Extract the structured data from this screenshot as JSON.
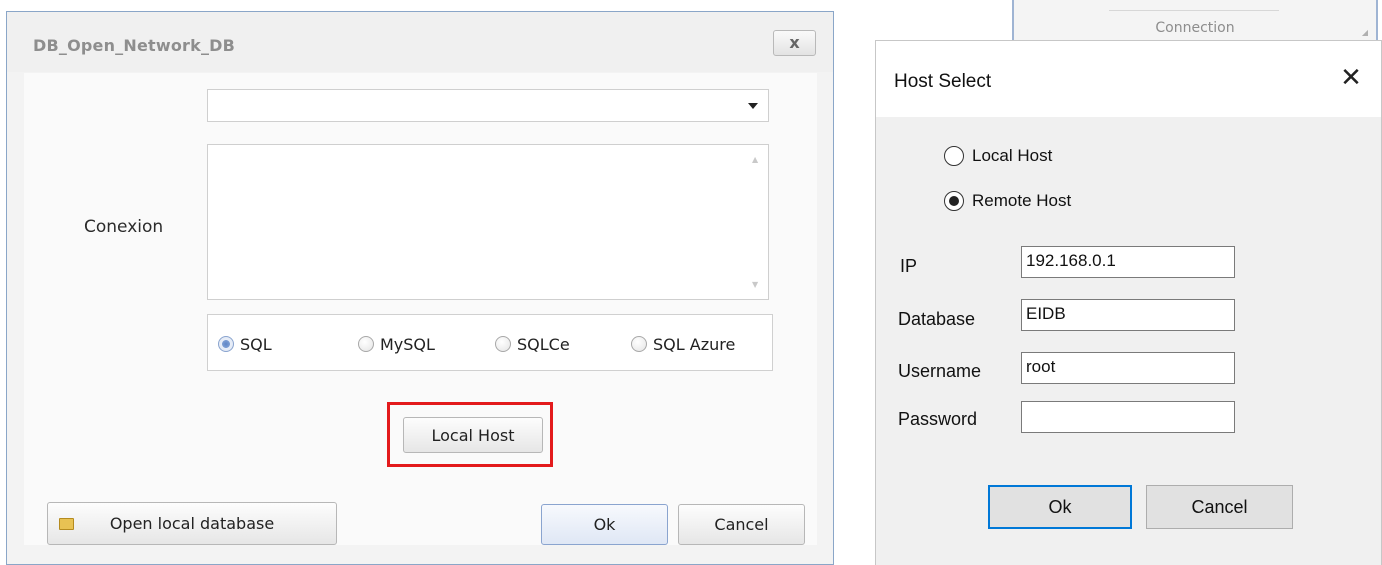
{
  "left_dialog": {
    "title": "DB_Open_Network_DB",
    "close_label": "x",
    "connection_combo_value": "",
    "conexion_label": "Conexion",
    "connection_string": "",
    "db_types": [
      {
        "label": "SQL",
        "selected": true
      },
      {
        "label": "MySQL",
        "selected": false
      },
      {
        "label": "SQLCe",
        "selected": false
      },
      {
        "label": "SQL Azure",
        "selected": false
      }
    ],
    "local_host_button": "Local Host",
    "open_local_button": "Open local database",
    "ok_button": "Ok",
    "cancel_button": "Cancel"
  },
  "background_window": {
    "tab_label": "Connection"
  },
  "host_dialog": {
    "title": "Host Select",
    "close_label": "✕",
    "host_options": [
      {
        "label": "Local Host",
        "selected": false
      },
      {
        "label": "Remote Host",
        "selected": true
      }
    ],
    "fields": {
      "ip_label": "IP",
      "ip_value": "192.168.0.1",
      "database_label": "Database",
      "database_value": "EIDB",
      "username_label": "Username",
      "username_value": "root",
      "password_label": "Password",
      "password_value": ""
    },
    "ok_button": "Ok",
    "cancel_button": "Cancel"
  },
  "colors": {
    "highlight": "#e31a1c",
    "default_button_border": "#0078d7"
  }
}
